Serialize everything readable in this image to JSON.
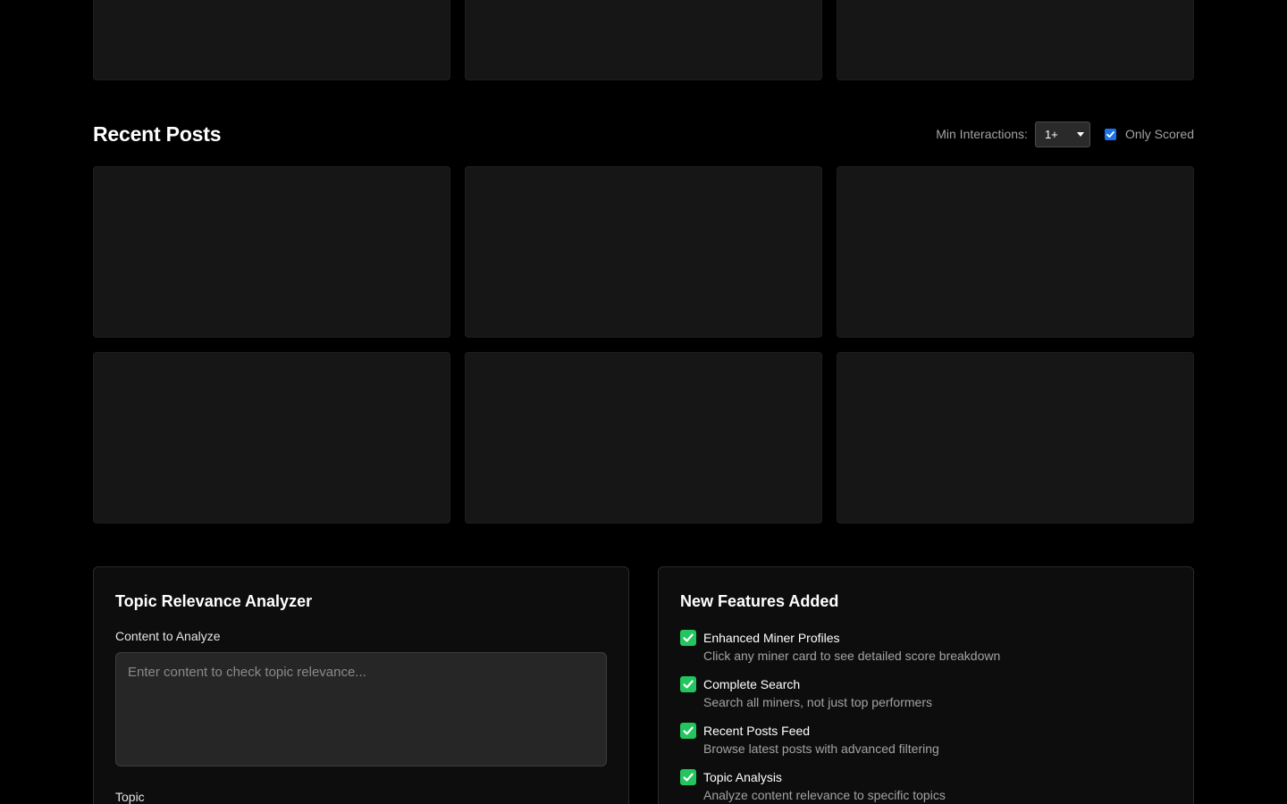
{
  "recent_posts": {
    "title": "Recent Posts",
    "filters": {
      "min_interactions_label": "Min Interactions:",
      "min_interactions_value": "1+",
      "only_scored_label": "Only Scored",
      "only_scored_checked": true
    }
  },
  "analyzer": {
    "title": "Topic Relevance Analyzer",
    "content_label": "Content to Analyze",
    "content_placeholder": "Enter content to check topic relevance...",
    "topic_label": "Topic"
  },
  "features": {
    "title": "New Features Added",
    "items": [
      {
        "title": "Enhanced Miner Profiles",
        "desc": "Click any miner card to see detailed score breakdown"
      },
      {
        "title": "Complete Search",
        "desc": "Search all miners, not just top performers"
      },
      {
        "title": "Recent Posts Feed",
        "desc": "Browse latest posts with advanced filtering"
      },
      {
        "title": "Topic Analysis",
        "desc": "Analyze content relevance to specific topics"
      }
    ]
  },
  "colors": {
    "accent": "#1a73e8",
    "success": "#22c55e",
    "card": "#161616",
    "background": "#000000"
  }
}
